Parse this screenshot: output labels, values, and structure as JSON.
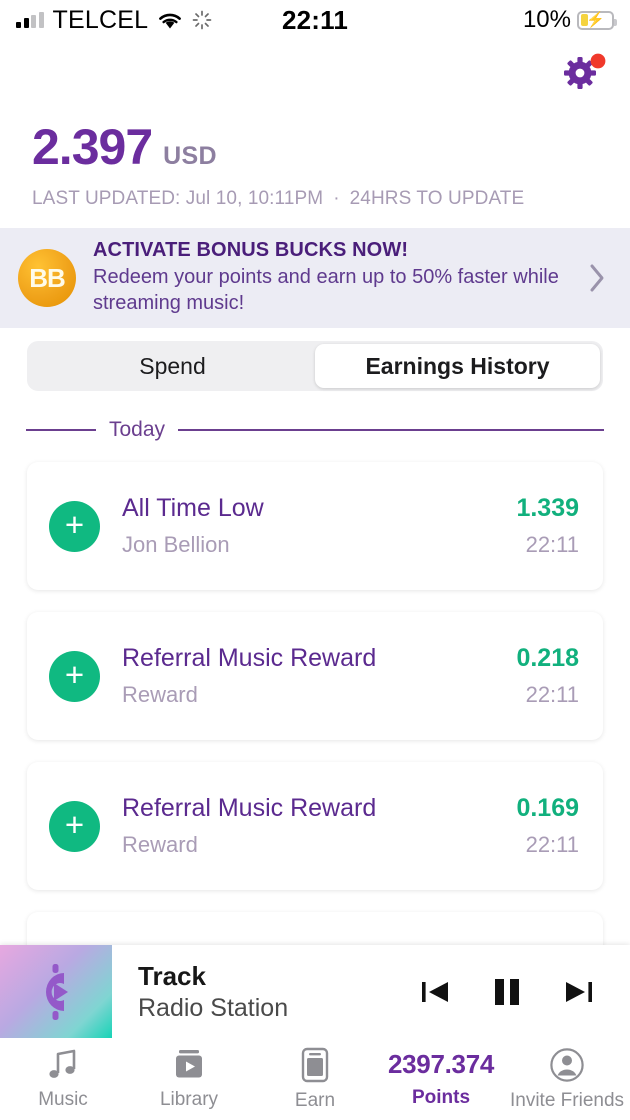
{
  "status_bar": {
    "carrier": "TELCEL",
    "time": "22:11",
    "battery_percent": "10%",
    "signal_icon": "signal-bars-icon",
    "wifi_icon": "wifi-icon",
    "sync_icon": "spinner-icon",
    "battery_icon": "battery-charging-icon"
  },
  "header": {
    "settings_icon": "gear-icon",
    "notification_dot_color": "#f0392b",
    "gear_color": "#6b2d9e"
  },
  "balance": {
    "amount": "2.397",
    "currency": "USD",
    "last_updated": "LAST UPDATED: Jul 10, 10:11PM",
    "separator": "·",
    "update_note": "24HRS TO UPDATE",
    "amount_color": "#6b2d9e"
  },
  "banner": {
    "badge_text": "BB",
    "title": "ACTIVATE BONUS BUCKS NOW!",
    "body": "Redeem your points and earn up to 50% faster while streaming music!",
    "chevron_icon": "chevron-right-icon",
    "background_color": "#ececf4"
  },
  "tabs": {
    "spend_label": "Spend",
    "earnings_label": "Earnings History",
    "active": "Earnings History"
  },
  "section": {
    "day_label": "Today"
  },
  "earnings": [
    {
      "icon": "plus-icon",
      "title": "All Time Low",
      "subtitle": "Jon Bellion",
      "amount": "1.339",
      "time": "22:11"
    },
    {
      "icon": "plus-icon",
      "title": "Referral Music Reward",
      "subtitle": "Reward",
      "amount": "0.218",
      "time": "22:11"
    },
    {
      "icon": "plus-icon",
      "title": "Referral Music Reward",
      "subtitle": "Reward",
      "amount": "0.169",
      "time": "22:11"
    }
  ],
  "player": {
    "artwork_icon": "cent-play-icon",
    "track_title": "Track",
    "track_subtitle": "Radio Station",
    "previous_icon": "skip-previous-icon",
    "pause_icon": "pause-icon",
    "next_icon": "skip-next-icon"
  },
  "tabbar": {
    "items": [
      {
        "icon": "music-note-icon",
        "label": "Music",
        "active": false
      },
      {
        "icon": "library-play-icon",
        "label": "Library",
        "active": false
      },
      {
        "icon": "phone-earn-icon",
        "label": "Earn",
        "active": false
      },
      {
        "icon": "points-value",
        "label": "Points",
        "value": "2397.374",
        "active": true
      },
      {
        "icon": "invite-person-icon",
        "label": "Invite Friends",
        "active": false
      }
    ]
  }
}
